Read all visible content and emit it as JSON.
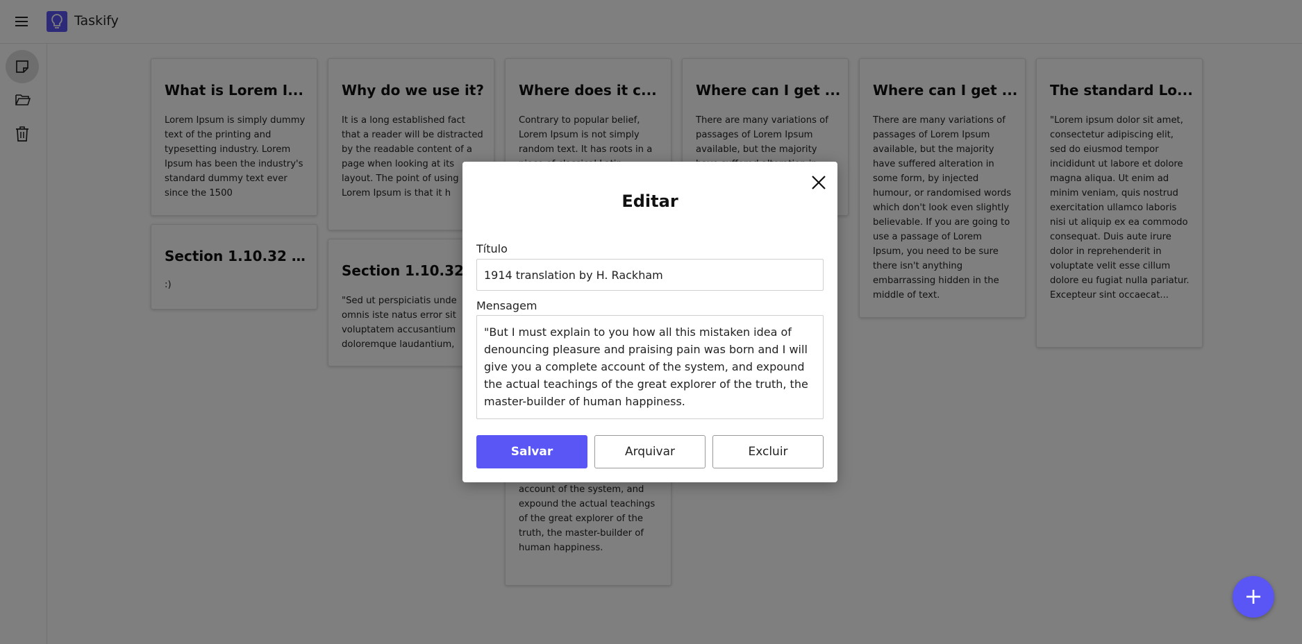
{
  "app": {
    "title": "Taskify"
  },
  "notes": [
    {
      "title": "What is Lorem I...",
      "body": "Lorem Ipsum is simply dummy text of the printing and typesetting industry. Lorem Ipsum has been the industry's standard dummy text ever since the 1500"
    },
    {
      "title": "Section 1.10.32 o...",
      "body": ":)"
    },
    {
      "title": "Why do we use it?",
      "body": "It is a long established fact that a reader will be distracted by the readable content of a page when looking at its layout. The point of using Lorem Ipsum is that it h"
    },
    {
      "title": "Section 1.10.32 of...",
      "body": "\"Sed ut perspiciatis unde omnis iste natus error sit voluptatem accusantium doloremque laudantium,"
    },
    {
      "title": "Where does it c...",
      "body": "Contrary to popular belief, Lorem Ipsum is not simply random text. It has roots in a piece of classical Latin"
    },
    {
      "title": "1914 translation...",
      "body": "account of the system, and expound the actual teachings of the great explorer of the truth, the master-builder of human happiness."
    },
    {
      "title": "Where can I get ...",
      "body": "There are many variations of passages of Lorem Ipsum available, but the majority have suffered alteration in"
    },
    {
      "title": "Where can I get ...",
      "body": "There are many variations of passages of Lorem Ipsum available, but the majority have suffered alteration in some form, by injected humour, or randomised words which don't look even slightly believable. If you are going to use a passage of Lorem Ipsum, you need to be sure there isn't anything embarrassing hidden in the middle of text."
    },
    {
      "title": "The standard Lo...",
      "body": "\"Lorem ipsum dolor sit amet, consectetur adipiscing elit, sed do eiusmod tempor incididunt ut labore et dolore magna aliqua. Ut enim ad minim veniam, quis nostrud exercitation ullamco laboris nisi ut aliquip ex ea commodo consequat. Duis aute irure dolor in reprehenderit in voluptate velit esse cillum dolore eu fugiat nulla pariatur. Excepteur sint occaecat..."
    }
  ],
  "fab": {
    "label": "+"
  },
  "modal": {
    "title": "Editar",
    "title_label": "Título",
    "title_value": "1914 translation by H. Rackham",
    "message_label": "Mensagem",
    "message_value": "\"But I must explain to you how all this mistaken idea of denouncing pleasure and praising pain was born and I will give you a complete account of the system, and expound the actual teachings of the great explorer of the truth, the master-builder of human happiness.",
    "save_label": "Salvar",
    "archive_label": "Arquivar",
    "delete_label": "Excluir"
  },
  "colors": {
    "accent": "#5a55f5",
    "overlay": "rgba(0,0,0,0.5)"
  },
  "icons": {
    "menu": "hamburger-icon",
    "logo": "lightbulb-icon",
    "notes": "note-icon",
    "archive": "folder-icon",
    "trash": "trash-icon",
    "close": "close-icon",
    "add": "plus-icon"
  }
}
